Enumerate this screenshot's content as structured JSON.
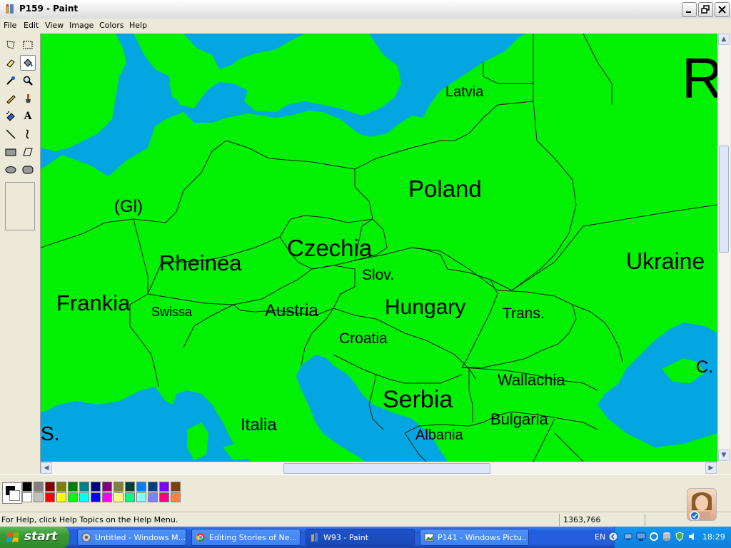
{
  "window": {
    "title": "P159 - Paint"
  },
  "menu": [
    "File",
    "Edit",
    "View",
    "Image",
    "Colors",
    "Help"
  ],
  "tools": [
    {
      "name": "free-form-select-icon"
    },
    {
      "name": "select-icon"
    },
    {
      "name": "eraser-icon"
    },
    {
      "name": "fill-with-color-icon"
    },
    {
      "name": "pick-color-icon"
    },
    {
      "name": "magnifier-icon"
    },
    {
      "name": "pencil-icon"
    },
    {
      "name": "brush-icon"
    },
    {
      "name": "airbrush-icon"
    },
    {
      "name": "text-icon",
      "glyph": "A"
    },
    {
      "name": "line-icon"
    },
    {
      "name": "curve-icon"
    },
    {
      "name": "rectangle-icon"
    },
    {
      "name": "polygon-icon"
    },
    {
      "name": "ellipse-icon"
    },
    {
      "name": "rounded-rectangle-icon"
    }
  ],
  "map_labels": {
    "latvia": "Latvia",
    "r": "R",
    "poland": "Poland",
    "gl": "(Gl)",
    "czechia": "Czechia",
    "rheinea": "Rheinea",
    "slov": "Slov.",
    "ukraine": "Ukraine",
    "frankia": "Frankia",
    "swissa": "Swissa",
    "austria": "Austria",
    "hungary": "Hungary",
    "trans": "Trans.",
    "croatia": "Croatia",
    "c": "C.",
    "wallachia": "Wallachia",
    "serbia": "Serbia",
    "s": "S.",
    "italia": "Italia",
    "bulgaria": "Bulgaria",
    "albania": "Albania"
  },
  "colors": {
    "land": "#02F002",
    "sea": "#03A6E0",
    "border": "#1A1A1A"
  },
  "palette": {
    "top": [
      "#000000",
      "#808080",
      "#800000",
      "#808000",
      "#008000",
      "#008080",
      "#000080",
      "#800080",
      "#808040",
      "#004040",
      "#0080FF",
      "#004080",
      "#8000FF",
      "#804000"
    ],
    "bottom": [
      "#FFFFFF",
      "#C0C0C0",
      "#FF0000",
      "#FFFF00",
      "#00FF00",
      "#00FFFF",
      "#0000FF",
      "#FF00FF",
      "#FFFF80",
      "#00FF80",
      "#80FFFF",
      "#8080FF",
      "#FF0080",
      "#FF8040"
    ]
  },
  "status": {
    "help": "For Help, click Help Topics on the Help Menu.",
    "coords": "1363,766"
  },
  "taskbar": {
    "start": "start",
    "tasks": [
      {
        "label": "Untitled - Windows M...",
        "icon": "windows-movie-maker-icon"
      },
      {
        "label": "Editing Stories of Ne...",
        "icon": "chrome-icon"
      },
      {
        "label": "W93 - Paint",
        "icon": "paint-icon"
      },
      {
        "label": "P141 - Windows Pictu...",
        "icon": "picture-viewer-icon"
      }
    ],
    "lang": "EN",
    "clock": "18:29"
  }
}
